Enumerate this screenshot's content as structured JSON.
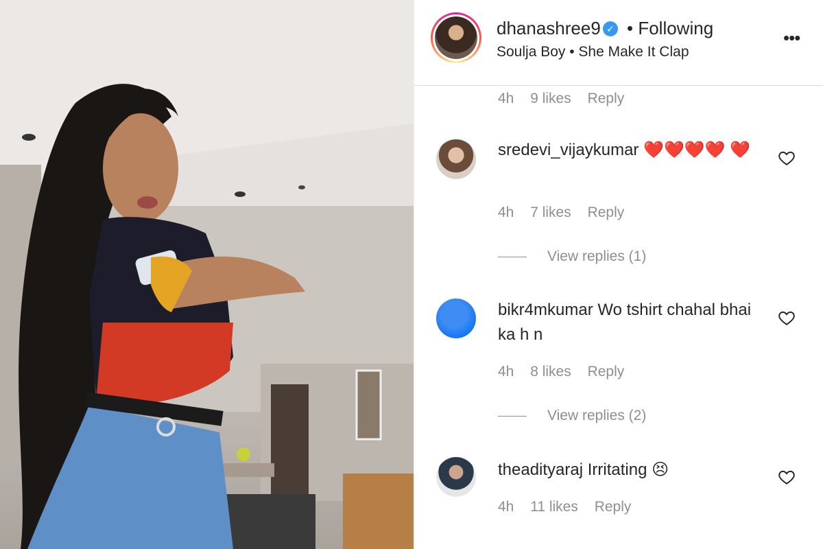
{
  "header": {
    "username": "dhanashree9",
    "verified_icon": "verified-badge-icon",
    "follow_status": "• Following",
    "audio": "Soulja Boy • She Make It Clap",
    "more_icon": "more-options-icon"
  },
  "comments": [
    {
      "meta": {
        "time": "4h",
        "likes": "9 likes",
        "reply": "Reply"
      }
    },
    {
      "username": "sredevi_vijaykumar",
      "text": "❤️❤️❤️❤️ ❤️",
      "meta": {
        "time": "4h",
        "likes": "7 likes",
        "reply": "Reply"
      },
      "view_replies": "View replies (1)"
    },
    {
      "username": "bikr4mkumar",
      "text": "Wo tshirt chahal bhai ka h n",
      "meta": {
        "time": "4h",
        "likes": "8 likes",
        "reply": "Reply"
      },
      "view_replies": "View replies (2)"
    },
    {
      "username": "theadityaraj",
      "text": "Irritating 😣",
      "meta": {
        "time": "4h",
        "likes": "11 likes",
        "reply": "Reply"
      }
    }
  ],
  "colors": {
    "text": "#262626",
    "secondary": "#8e8e8e",
    "verified": "#3897f0",
    "heart_emoji": "#e0141e",
    "avatar_blue": "#1877f2"
  }
}
